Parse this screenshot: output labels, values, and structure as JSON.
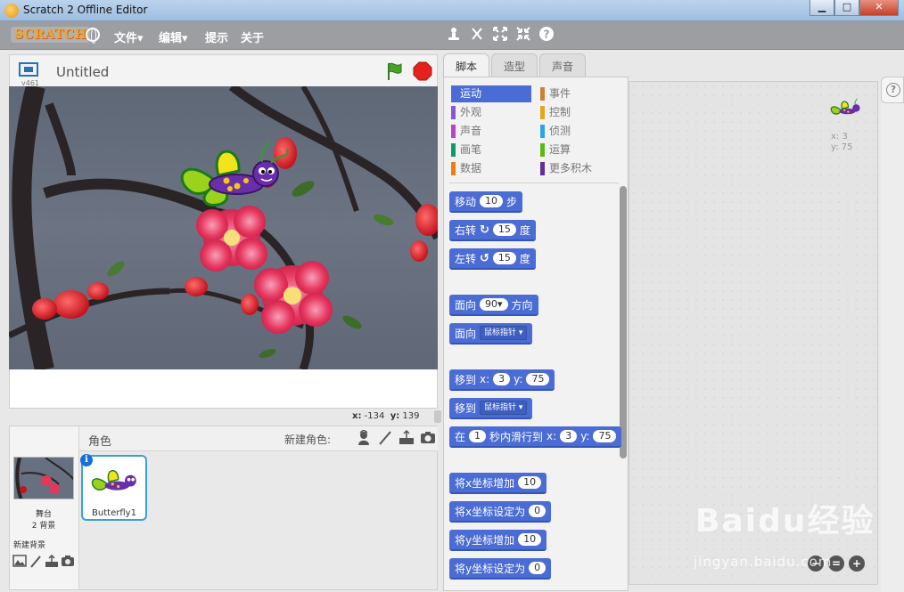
{
  "window": {
    "title": "Scratch 2 Offline Editor",
    "minimize": "▁",
    "maximize": "□",
    "close": "✕"
  },
  "menubar": {
    "logo": "SCRATCH",
    "items": [
      "文件▾",
      "编辑▾",
      "提示",
      "关于"
    ],
    "tool_icons": [
      "duplicate-icon",
      "cut-icon",
      "grow-icon",
      "shrink-icon",
      "help-icon"
    ]
  },
  "stage_header": {
    "version": "v461",
    "project_title": "Untitled"
  },
  "stage_coords": {
    "x_label": "x:",
    "x": "-134",
    "y_label": "y:",
    "y": "139"
  },
  "sprites": {
    "header": "角色",
    "new_sprite_label": "新建角色:",
    "stage_label": "舞台",
    "backdrop_count": "2 背景",
    "new_backdrop_label": "新建背景",
    "items": [
      {
        "name": "Butterfly1",
        "selected": true
      }
    ]
  },
  "tabs": [
    {
      "label": "脚本",
      "active": true
    },
    {
      "label": "造型",
      "active": false
    },
    {
      "label": "声音",
      "active": false
    }
  ],
  "categories": [
    {
      "label": "运动",
      "color": "#4a6cd4",
      "active": true
    },
    {
      "label": "事件",
      "color": "#c88330"
    },
    {
      "label": "外观",
      "color": "#8a55d7"
    },
    {
      "label": "控制",
      "color": "#e1a91a"
    },
    {
      "label": "声音",
      "color": "#bb42c3"
    },
    {
      "label": "侦测",
      "color": "#2ca5e2"
    },
    {
      "label": "画笔",
      "color": "#0e9a6c"
    },
    {
      "label": "运算",
      "color": "#5cb712"
    },
    {
      "label": "数据",
      "color": "#ee7d16"
    },
    {
      "label": "更多积木",
      "color": "#632d99"
    }
  ],
  "blocks": {
    "move": {
      "label": "移动",
      "value": "10",
      "unit": "步"
    },
    "turn_right": {
      "label": "右转",
      "value": "15",
      "unit": "度"
    },
    "turn_left": {
      "label": "左转",
      "value": "15",
      "unit": "度"
    },
    "point_dir": {
      "label": "面向",
      "value": "90▾",
      "unit": "方向"
    },
    "point_towards": {
      "label": "面向",
      "value": "鼠标指针"
    },
    "goto_xy": {
      "label": "移到",
      "x_label": "x:",
      "x": "3",
      "y_label": "y:",
      "y": "75"
    },
    "goto": {
      "label": "移到",
      "value": "鼠标指针"
    },
    "glide": {
      "label": "在",
      "secs": "1",
      "mid": "秒内滑行到",
      "x_label": "x:",
      "x": "3",
      "y_label": "y:",
      "y": "75"
    },
    "change_x": {
      "label": "将x坐标增加",
      "value": "10"
    },
    "set_x": {
      "label": "将x坐标设定为",
      "value": "0"
    },
    "change_y": {
      "label": "将y坐标增加",
      "value": "10"
    },
    "set_y": {
      "label": "将y坐标设定为",
      "value": "0"
    }
  },
  "scripts_area": {
    "sprite_x_label": "x:",
    "sprite_x": "3",
    "sprite_y_label": "y:",
    "sprite_y": "75",
    "zoom_out": "−",
    "zoom_reset": "=",
    "zoom_in": "+"
  },
  "watermark": {
    "main": "Baidu经验",
    "sub": "jingyan.baidu.com"
  }
}
